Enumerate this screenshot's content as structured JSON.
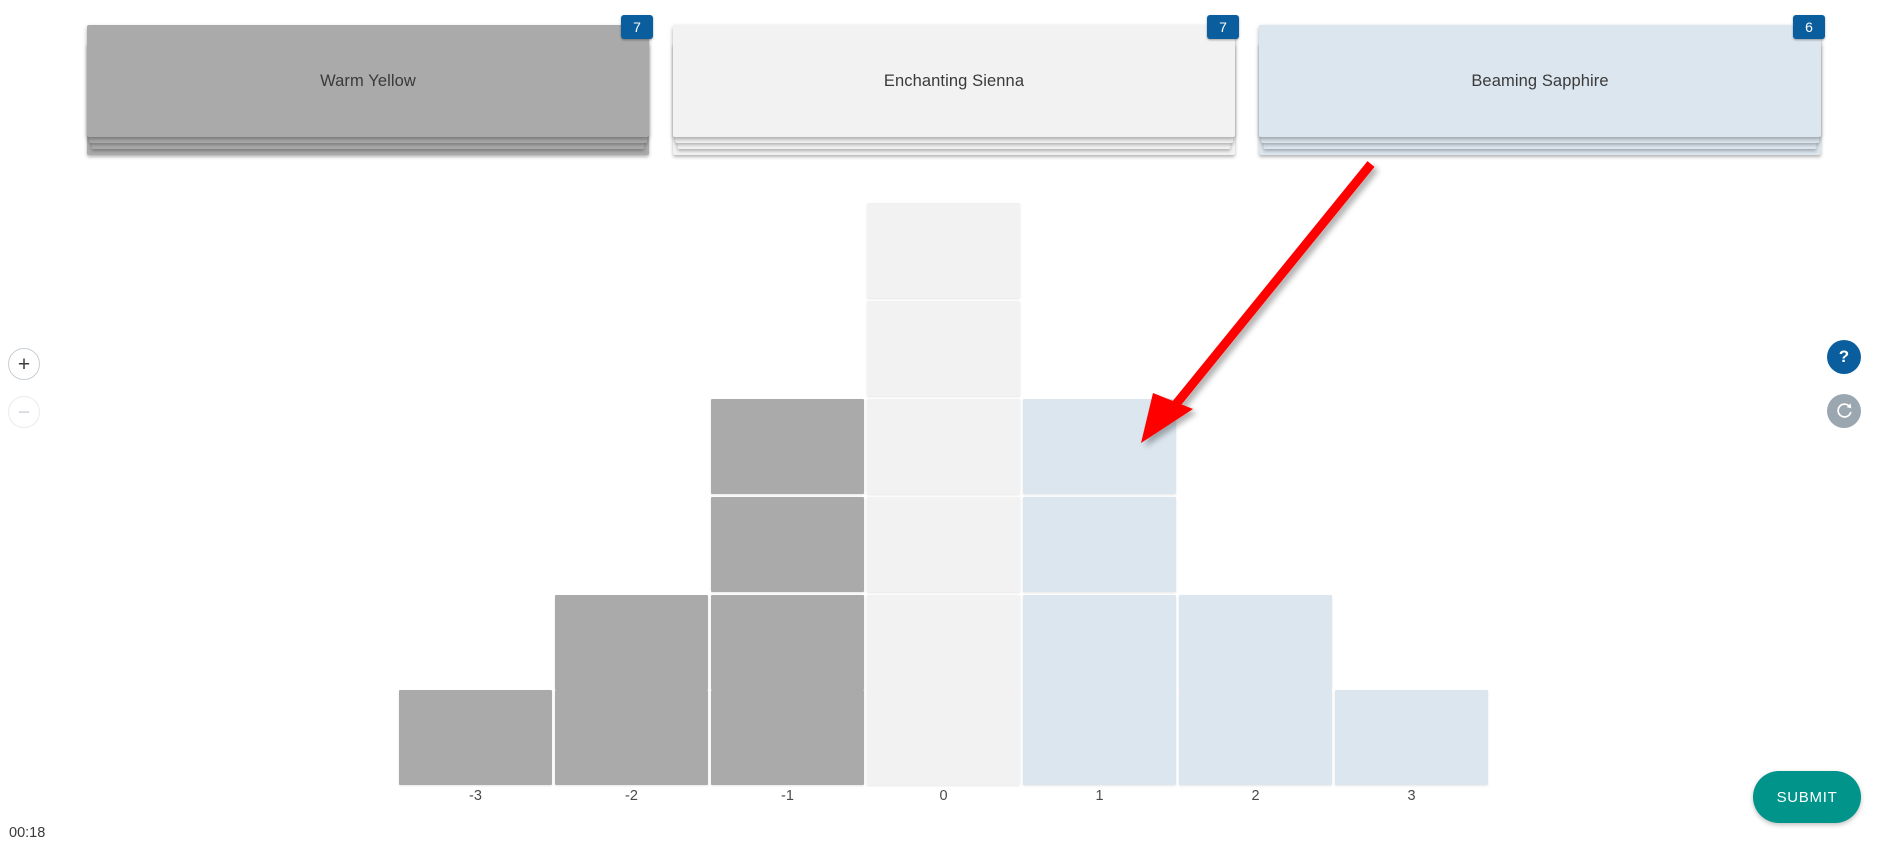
{
  "cards": [
    {
      "label": "Warm Yellow",
      "badge": "7",
      "color": "#AAAAAA"
    },
    {
      "label": "Enchanting Sienna",
      "badge": "7",
      "color": "#F2F2F2"
    },
    {
      "label": "Beaming Sapphire",
      "badge": "6",
      "color": "#DCE6EF"
    }
  ],
  "chart_data": {
    "type": "bar",
    "title": "",
    "xlabel": "",
    "ylabel": "",
    "categories": [
      "-3",
      "-2",
      "-1",
      "0",
      "1",
      "2",
      "3"
    ],
    "values": [
      1,
      2,
      4,
      6,
      4,
      2,
      1
    ],
    "ylim": [
      0,
      6
    ],
    "grid": false,
    "legend": "none",
    "stacked_unit_cells": true,
    "bar_colors": [
      "#AAAAAA",
      "#AAAAAA",
      "#AAAAAA",
      "#F2F2F2",
      "#DCE6EF",
      "#DCE6EF",
      "#DCE6EF"
    ],
    "annotations": [
      {
        "type": "arrow",
        "color": "#FF0000",
        "points_to": "1",
        "target_cell_index": 4
      }
    ]
  },
  "controls": {
    "zoom_in_label": "+",
    "zoom_out_label": "−",
    "help_label": "?",
    "reset_label": ""
  },
  "footer": {
    "timer": "00:18",
    "submit_label": "SUBMIT"
  },
  "colors": {
    "badge_blue": "#0B5E9E",
    "submit_teal": "#00948A",
    "arrow_red": "#FF0000",
    "gray_swatch": "#AAAAAA",
    "white_swatch": "#F2F2F2",
    "blue_swatch": "#DCE6EF"
  }
}
